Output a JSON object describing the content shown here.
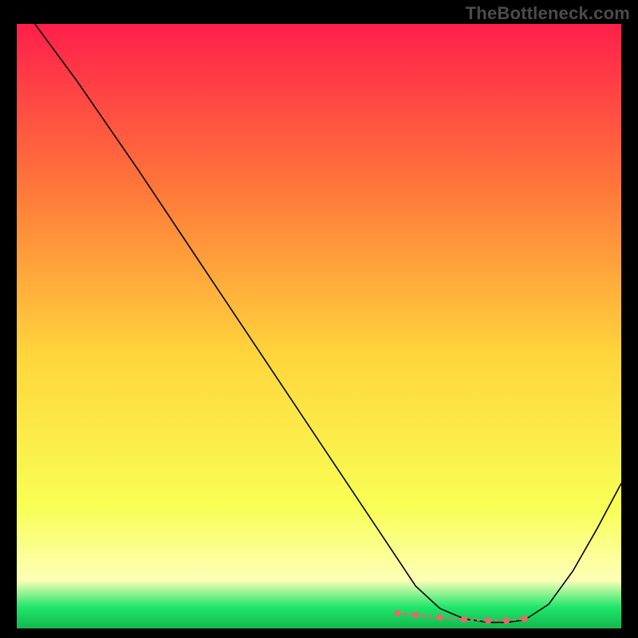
{
  "watermark": "TheBottleneck.com",
  "chart_data": {
    "type": "line",
    "title": "",
    "xlabel": "",
    "ylabel": "",
    "xlim": [
      0,
      100
    ],
    "ylim": [
      0,
      100
    ],
    "gradient_colors": {
      "top": "#ff1f4b",
      "upper_mid": "#ff7a3a",
      "mid": "#ffd63c",
      "lower_mid": "#f8ff55",
      "pale": "#fdffb7",
      "green_band": "#1ee66a",
      "bottom": "#14b84e"
    },
    "series": [
      {
        "name": "curve",
        "color": "#000000",
        "x": [
          3,
          10,
          20,
          30,
          40,
          50,
          60,
          63,
          66,
          70,
          74,
          78,
          81,
          84,
          88,
          92,
          96,
          100
        ],
        "y": [
          100,
          90.5,
          76,
          61,
          46,
          31,
          16,
          11.5,
          7,
          3.3,
          1.6,
          1.0,
          1.0,
          1.4,
          4.0,
          9.5,
          16.5,
          24
        ]
      },
      {
        "name": "dotted-bottom",
        "color": "#e26a6a",
        "style": "dotted",
        "x": [
          63,
          66,
          70,
          74,
          78,
          81,
          84
        ],
        "y": [
          2.5,
          2.2,
          1.8,
          1.5,
          1.3,
          1.3,
          1.6
        ]
      }
    ]
  }
}
